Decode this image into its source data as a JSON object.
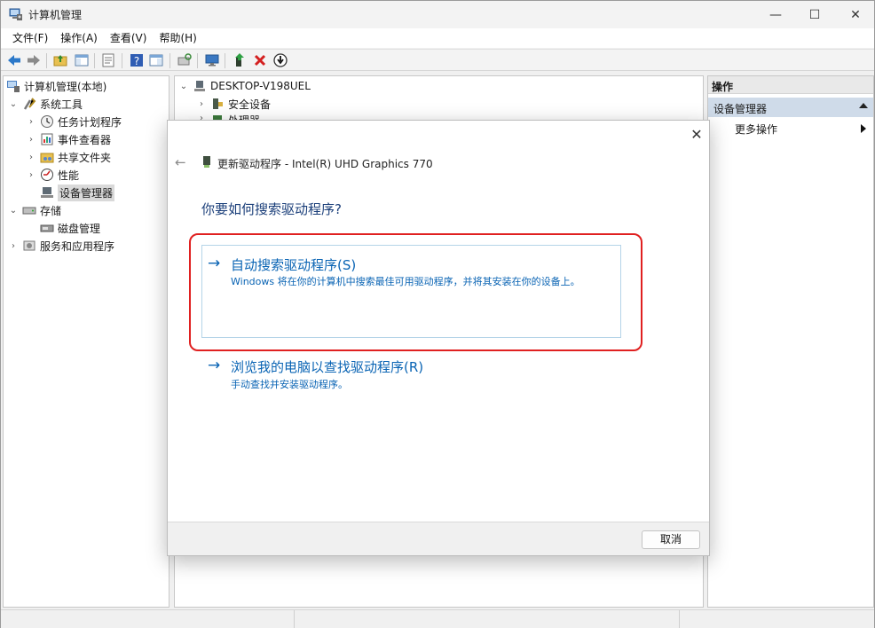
{
  "window": {
    "title": "计算机管理",
    "controls": {
      "minimize": "—",
      "maximize": "☐",
      "close": "✕"
    }
  },
  "menubar": [
    "文件(F)",
    "操作(A)",
    "查看(V)",
    "帮助(H)"
  ],
  "toolbar": {
    "icons": [
      "back-arrow-icon",
      "forward-arrow-icon",
      "folder-up-icon",
      "show-hide-tree-icon",
      "properties-icon",
      "help-icon",
      "show-action-pane-icon",
      "scan-hardware-icon",
      "monitor-icon",
      "update-driver-icon",
      "uninstall-icon",
      "disable-icon"
    ]
  },
  "left_tree": {
    "root": "计算机管理(本地)",
    "system_tools": "系统工具",
    "task_scheduler": "任务计划程序",
    "event_viewer": "事件查看器",
    "shared_folders": "共享文件夹",
    "performance": "性能",
    "device_manager": "设备管理器",
    "storage": "存储",
    "disk_management": "磁盘管理",
    "services_apps": "服务和应用程序"
  },
  "mid_tree": {
    "computer": "DESKTOP-V198UEL",
    "security_devices": "安全设备",
    "processors": "处理器"
  },
  "actions": {
    "header": "操作",
    "section": "设备管理器",
    "more": "更多操作"
  },
  "dialog": {
    "close": "✕",
    "back": "←",
    "title": "更新驱动程序 - Intel(R) UHD Graphics 770",
    "question": "你要如何搜索驱动程序?",
    "option1": {
      "arrow": "→",
      "title": "自动搜索驱动程序(S)",
      "desc": "Windows 将在你的计算机中搜索最佳可用驱动程序，并将其安装在你的设备上。"
    },
    "option2": {
      "arrow": "→",
      "title": "浏览我的电脑以查找驱动程序(R)",
      "desc": "手动查找并安装驱动程序。"
    },
    "cancel": "取消"
  },
  "colors": {
    "link_blue": "#0a64b4",
    "highlight_red": "#e02020",
    "action_section_bg": "#cfdbe9"
  }
}
